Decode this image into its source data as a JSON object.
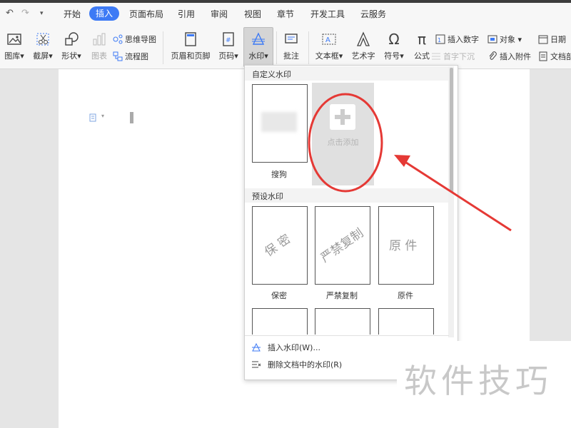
{
  "menubar": {
    "quick_icons": [
      "undo-icon",
      "redo-icon",
      "customize-dropdown-icon"
    ],
    "items": [
      "开始",
      "插入",
      "页面布局",
      "引用",
      "审阅",
      "视图",
      "章节",
      "开发工具",
      "云服务"
    ],
    "active_label": "插入",
    "active_color": "#3d7af5"
  },
  "ribbon": {
    "tools": [
      "图库",
      "截屏",
      "形状",
      "图表",
      "页眉和页脚",
      "页码",
      "水印",
      "批注",
      "文本框",
      "艺术字",
      "符号",
      "公式"
    ],
    "small_tools": [
      "思维导图",
      "流程图",
      "插入数字",
      "对象",
      "日期",
      "首字下沉",
      "插入附件",
      "文档部"
    ]
  },
  "watermark_menu": {
    "custom_section": "自定义水印",
    "custom_items": [
      {
        "label": "搜狗"
      }
    ],
    "add_label": "点击添加",
    "preset_section": "预设水印",
    "presets": [
      {
        "label": "保密",
        "text": "保 密"
      },
      {
        "label": "严禁复制",
        "text": "严禁复制"
      },
      {
        "label": "原件",
        "text": "原 件"
      }
    ],
    "insert_label": "插入水印(W)...",
    "delete_label": "删除文档中的水印(R)"
  },
  "brand_watermark": "软件技巧",
  "annotation_color": "#e53935"
}
